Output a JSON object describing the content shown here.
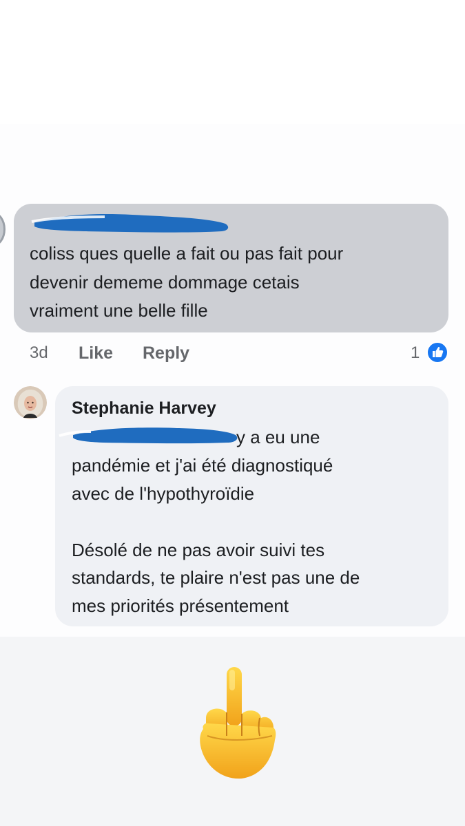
{
  "comment": {
    "lines": [
      "coliss ques quelle a fait ou pas fait pour",
      "devenir dememe dommage cetais",
      "vraiment une belle fille"
    ],
    "time": "3d",
    "like_label": "Like",
    "reply_label": "Reply",
    "reaction_count": "1",
    "reaction_icon": "thumbs-up-icon",
    "redaction_color": "#1f6cbf"
  },
  "reply": {
    "author": "Stephanie Harvey",
    "first_line_tail": "y a eu une",
    "lines": [
      "pandémie et j'ai été diagnostiqué",
      "avec de l'hypothyroïdie",
      "",
      "Désolé de ne pas avoir suivi tes",
      "standards, te plaire n'est pas une de",
      "mes priorités présentement"
    ]
  },
  "emoji": {
    "name": "middle-finger-emoji",
    "color": "#f6b41d"
  }
}
